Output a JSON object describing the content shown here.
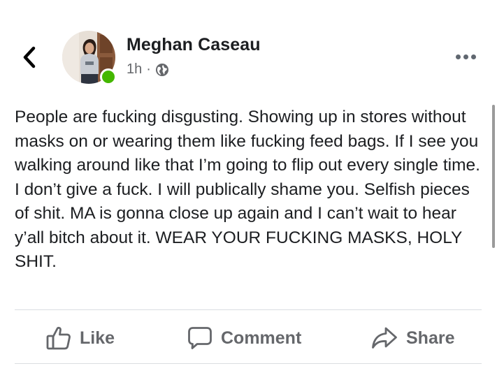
{
  "post": {
    "author": "Meghan Caseau",
    "time": "1h",
    "separator": "·",
    "privacy_icon": "globe-icon",
    "online": true,
    "text": "People are fucking disgusting. Showing up in stores without masks on or wearing them like fucking feed bags. If I see you walking around like that I’m going to flip out every single time. I don’t give a fuck. I will publically shame you. Selfish pieces of shit. MA is gonna close up again and I can’t wait to hear y’all bitch about it. WEAR YOUR FUCKING MASKS, HOLY SHIT."
  },
  "actions": {
    "like_label": "Like",
    "comment_label": "Comment",
    "share_label": "Share"
  },
  "colors": {
    "online_indicator": "#44b700",
    "action_text": "#65676b",
    "body_text": "#1c1e21",
    "divider": "#dadde1"
  },
  "icons": {
    "back": "chevron-left-icon",
    "more": "more-horizontal-icon",
    "like": "thumbs-up-icon",
    "comment": "comment-bubble-icon",
    "share": "share-arrow-icon"
  }
}
